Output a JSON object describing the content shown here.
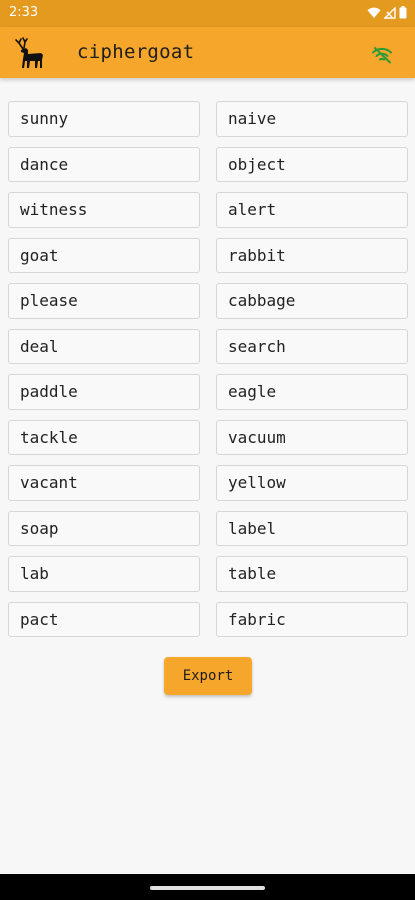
{
  "status_bar": {
    "time": "2:33"
  },
  "app_bar": {
    "title": "ciphergoat",
    "logo_icon": "deer-logo-icon",
    "status_icon": "wifi-off-icon"
  },
  "words": [
    "sunny",
    "naive",
    "dance",
    "object",
    "witness",
    "alert",
    "goat",
    "rabbit",
    "please",
    "cabbage",
    "deal",
    "search",
    "paddle",
    "eagle",
    "tackle",
    "vacuum",
    "vacant",
    "yellow",
    "soap",
    "label",
    "lab",
    "table",
    "pact",
    "fabric"
  ],
  "export_button": {
    "label": "Export"
  },
  "colors": {
    "accent": "#f6a62b",
    "status_bar": "#e49a1f",
    "wifi_off_icon": "#2e9a35",
    "background": "#f7f7f7"
  }
}
